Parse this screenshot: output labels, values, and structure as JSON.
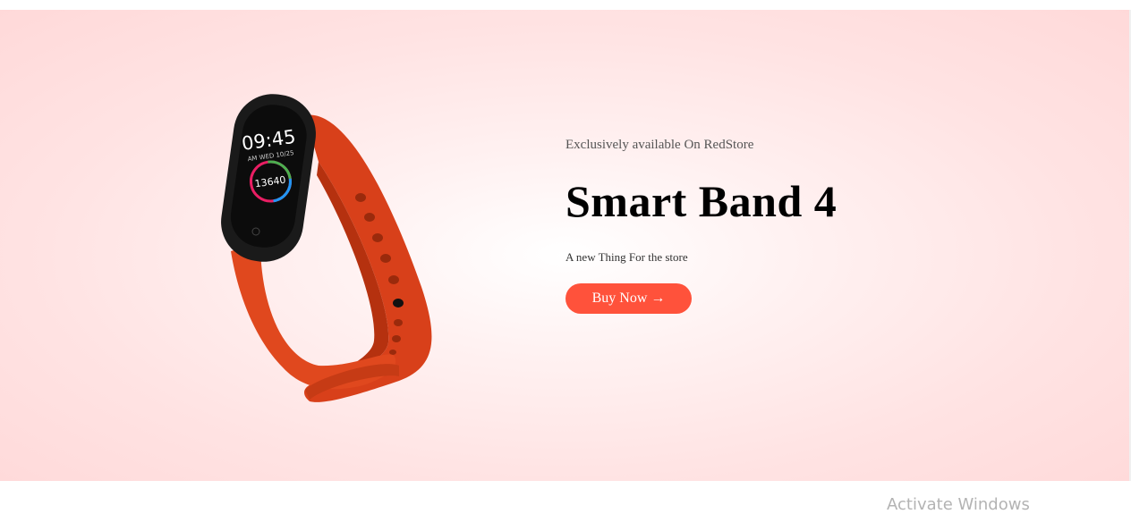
{
  "hero": {
    "kicker": "Exclusively available On RedStore",
    "title": "Smart Band 4",
    "description": "A new Thing For the store",
    "buy_button_label": "Buy Now",
    "buy_button_arrow": "→",
    "accent_color": "#ff523b",
    "product_screen": {
      "time": "09:45",
      "date": "AM WED 10/25",
      "steps": "13640"
    }
  },
  "watermark": {
    "text": "Activate Windows"
  }
}
